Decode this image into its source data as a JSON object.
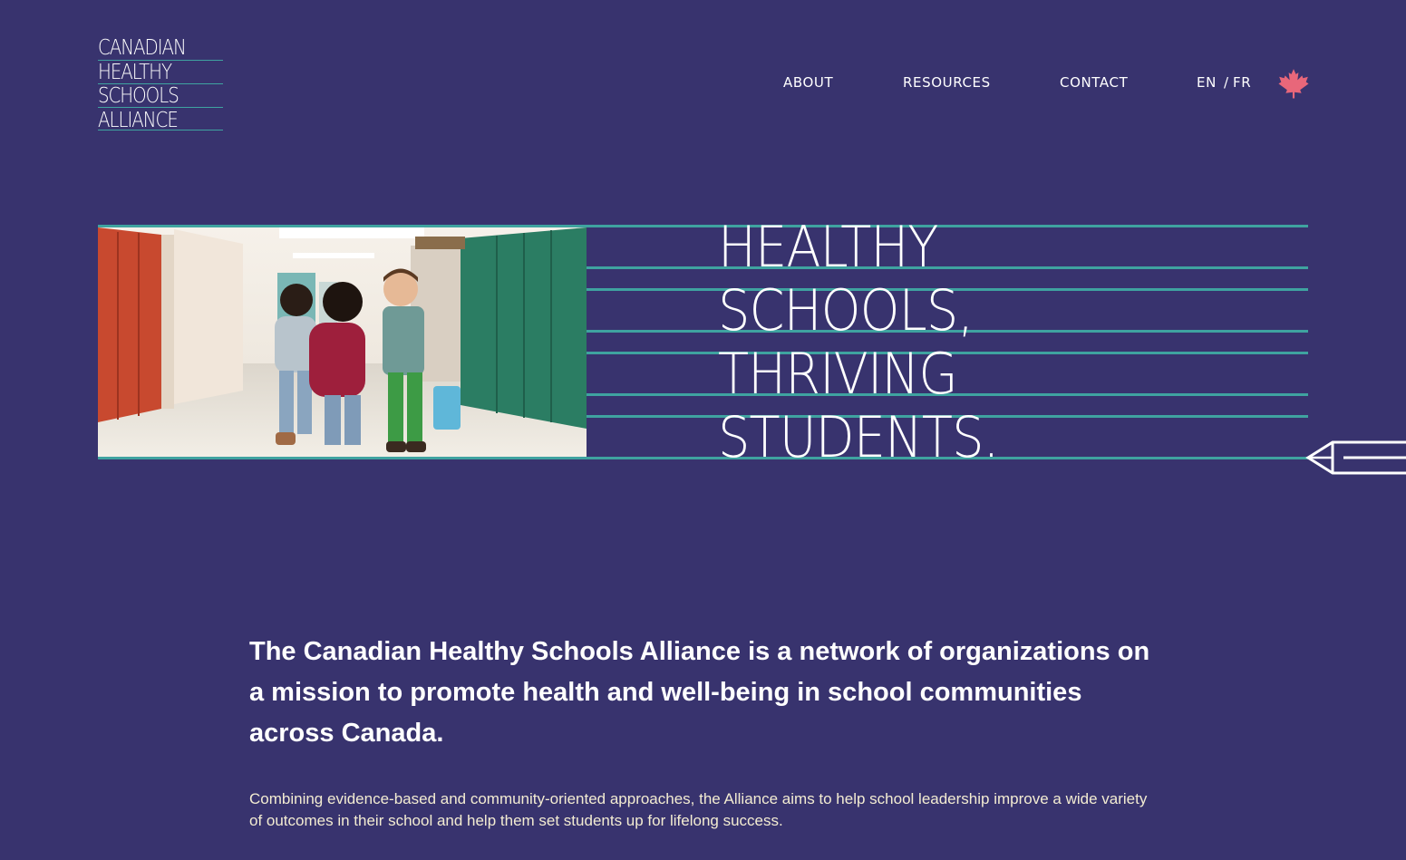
{
  "logo": {
    "lines": [
      "CANADIAN",
      "HEALTHY",
      "SCHOOLS",
      "ALLIANCE"
    ]
  },
  "nav": {
    "about": "ABOUT",
    "resources": "RESOURCES",
    "contact": "CONTACT"
  },
  "language": {
    "en": "EN",
    "separator": "/",
    "fr": "FR"
  },
  "hero": {
    "heading_lines": [
      "HEALTHY",
      "SCHOOLS,",
      "THRIVING",
      "STUDENTS."
    ],
    "photo_alt": "children-walking-in-school-hallway"
  },
  "intro": {
    "lead": "The Canadian Healthy Schools Alliance is a network of organizations on a mission to promote health and well-being in school communities across Canada.",
    "body": "Combining evidence-based and community-oriented approaches, the Alliance aims to help school leadership improve a wide variety of outcomes in their school and help them set students up for lifelong success."
  },
  "icons": {
    "flag": "maple-leaf-icon",
    "decoration": "pencil-icon"
  },
  "colors": {
    "background": "#38336e",
    "rule_teal": "#3fa3a0",
    "maple_pink": "#e8677a",
    "body_text": "#f3ecd2"
  }
}
